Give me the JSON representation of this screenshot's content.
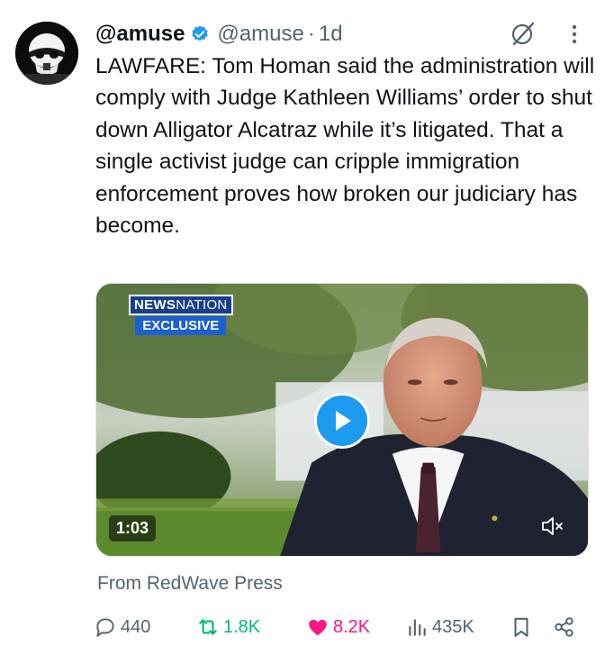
{
  "tweet": {
    "display_name": "@amuse",
    "handle": "@amuse",
    "separator": "·",
    "time": "1d",
    "text": "LAWFARE: Tom Homan said the administration will comply with Judge Kathleen Williams’ order to shut down Alligator Alcatraz while it’s litigated. That a single activist judge can cripple immigration enforcement proves how broken our judiciary has become."
  },
  "video": {
    "badge_brand_bold": "NEWS",
    "badge_brand_light": "NATION",
    "badge_label": "EXCLUSIVE",
    "duration": "1:03"
  },
  "source": "From RedWave Press",
  "actions": {
    "replies": "440",
    "reposts": "1.8K",
    "likes": "8.2K",
    "views": "435K"
  },
  "icons": [
    "avatar-stormtrooper",
    "verified-icon",
    "grok-icon",
    "more-icon",
    "play-icon",
    "mute-icon",
    "reply-icon",
    "repost-icon",
    "like-icon",
    "views-icon",
    "bookmark-icon",
    "share-icon"
  ],
  "colors": {
    "accent": "#1d9bf0",
    "repost": "#00ba7c",
    "like": "#f91880",
    "secondary_text": "#536471"
  }
}
